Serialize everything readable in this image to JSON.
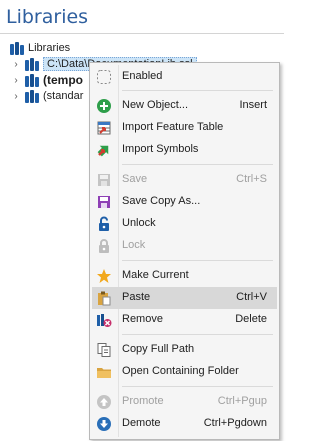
{
  "panel": {
    "title": "Libraries"
  },
  "tree": {
    "root_label": "Libraries",
    "items": [
      {
        "label": "C:\\Data\\DocumentationLib.ssl"
      },
      {
        "label": "(tempo"
      },
      {
        "label": "(standar"
      }
    ]
  },
  "menu": {
    "enabled": "Enabled",
    "new_object": {
      "label": "New Object...",
      "shortcut": "Insert"
    },
    "import_feature_table": "Import Feature Table",
    "import_symbols": "Import Symbols",
    "save": {
      "label": "Save",
      "shortcut": "Ctrl+S"
    },
    "save_copy_as": "Save Copy As...",
    "unlock": "Unlock",
    "lock": "Lock",
    "make_current": "Make Current",
    "paste": {
      "label": "Paste",
      "shortcut": "Ctrl+V"
    },
    "remove": {
      "label": "Remove",
      "shortcut": "Delete"
    },
    "copy_full_path": "Copy Full Path",
    "open_containing_folder": "Open Containing Folder",
    "promote": {
      "label": "Promote",
      "shortcut": "Ctrl+Pgup"
    },
    "demote": {
      "label": "Demote",
      "shortcut": "Ctrl+Pgdown"
    }
  },
  "colors": {
    "title_blue": "#2f5f9e",
    "library_blue": "#1f5fa8",
    "hover_gray": "#d8d8d8",
    "selection": "#cce4f7"
  }
}
